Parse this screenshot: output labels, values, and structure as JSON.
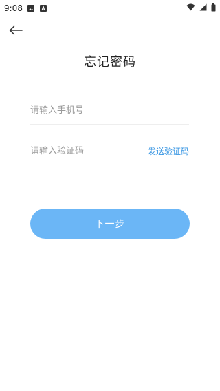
{
  "status_bar": {
    "time": "9:08",
    "icons_left": [
      "image-icon",
      "font-icon"
    ],
    "icons_right": [
      "wifi-icon",
      "signal-icon",
      "battery-icon"
    ]
  },
  "header": {
    "back_icon": "arrow-left-icon",
    "title": "忘记密码"
  },
  "form": {
    "phone_placeholder": "请输入手机号",
    "code_placeholder": "请输入验证码",
    "send_code_label": "发送验证码",
    "next_label": "下一步"
  },
  "colors": {
    "accent": "#6bb6f6",
    "link": "#3a97e3",
    "divider": "#eeeeee"
  }
}
